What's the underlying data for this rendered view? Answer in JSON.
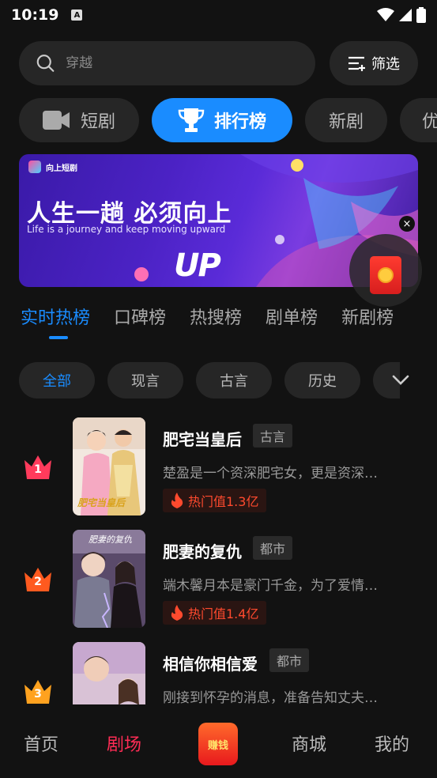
{
  "status": {
    "time": "10:19",
    "notif_icon": "A"
  },
  "search": {
    "placeholder": "穿越",
    "filter_label": "筛选"
  },
  "main_tabs": [
    {
      "label": "短剧",
      "icon": "video-camera-icon"
    },
    {
      "label": "排行榜",
      "icon": "trophy-icon",
      "active": true
    },
    {
      "label": "新剧"
    },
    {
      "label": "优"
    }
  ],
  "banner": {
    "brand": "向上短剧",
    "headline": "人生一趟  必须向上",
    "subline": "Life is a journey and  keep moving upward",
    "art_text": "UP",
    "close": "×"
  },
  "rank_tabs": [
    "实时热榜",
    "口碑榜",
    "热搜榜",
    "剧单榜",
    "新剧榜"
  ],
  "chips": [
    "全部",
    "现言",
    "古言",
    "历史"
  ],
  "items": [
    {
      "rank": "1",
      "title": "肥宅当皇后",
      "tag": "古言",
      "desc": "楚盈是一个资深肥宅女，更是资深…",
      "hot": "热门值1.3亿",
      "crown_color": "#ff3b5c",
      "poster_text": "肥宅当皇后"
    },
    {
      "rank": "2",
      "title": "肥妻的复仇",
      "tag": "都市",
      "desc": "端木馨月本是豪门千金，为了爱情…",
      "hot": "热门值1.4亿",
      "crown_color": "#ff5a1f",
      "poster_text": "肥妻的复仇"
    },
    {
      "rank": "3",
      "title": "相信你相信爱",
      "tag": "都市",
      "desc": "刚接到怀孕的消息，准备告知丈夫…",
      "hot": "",
      "crown_color": "#ffa21f",
      "poster_text": ""
    }
  ],
  "nav": {
    "home": "首页",
    "theater": "剧场",
    "earn": "赚钱",
    "mall": "商城",
    "mine": "我的"
  },
  "colors": {
    "accent": "#1a8cff",
    "nav_active": "#ff2c55",
    "hot": "#ff4a2e"
  }
}
